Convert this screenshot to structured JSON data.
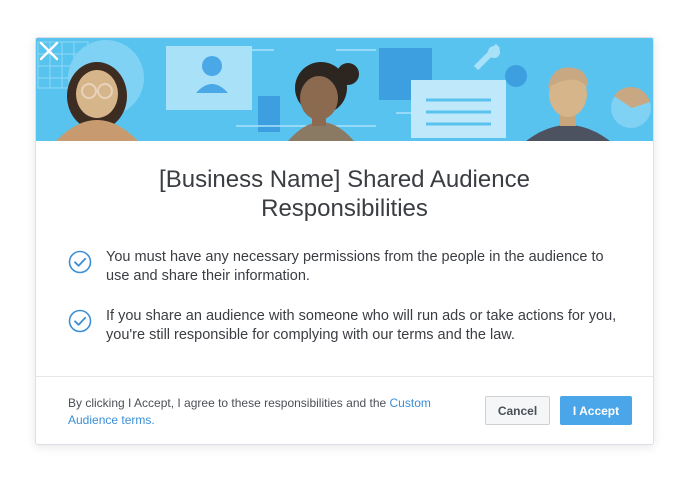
{
  "dialog": {
    "title": "[Business Name] Shared Audience Responsibilities",
    "items": [
      {
        "text": "You must have any necessary permissions from the people in the audience to use and share their information."
      },
      {
        "text": "If you share an audience with someone who will run ads or take actions for you, you're still responsible for complying with our terms and the law."
      }
    ],
    "footer": {
      "prefix": "By clicking I Accept, I agree to these responsibilities and the ",
      "link": "Custom Audience terms."
    },
    "buttons": {
      "cancel": "Cancel",
      "accept": "I Accept"
    }
  },
  "icons": {
    "close": "close-icon",
    "check": "check-circle-icon"
  },
  "colors": {
    "banner": "#58c3ee",
    "accent": "#4aa6e8",
    "link": "#3b8fd6",
    "check": "#3b8fd6"
  }
}
